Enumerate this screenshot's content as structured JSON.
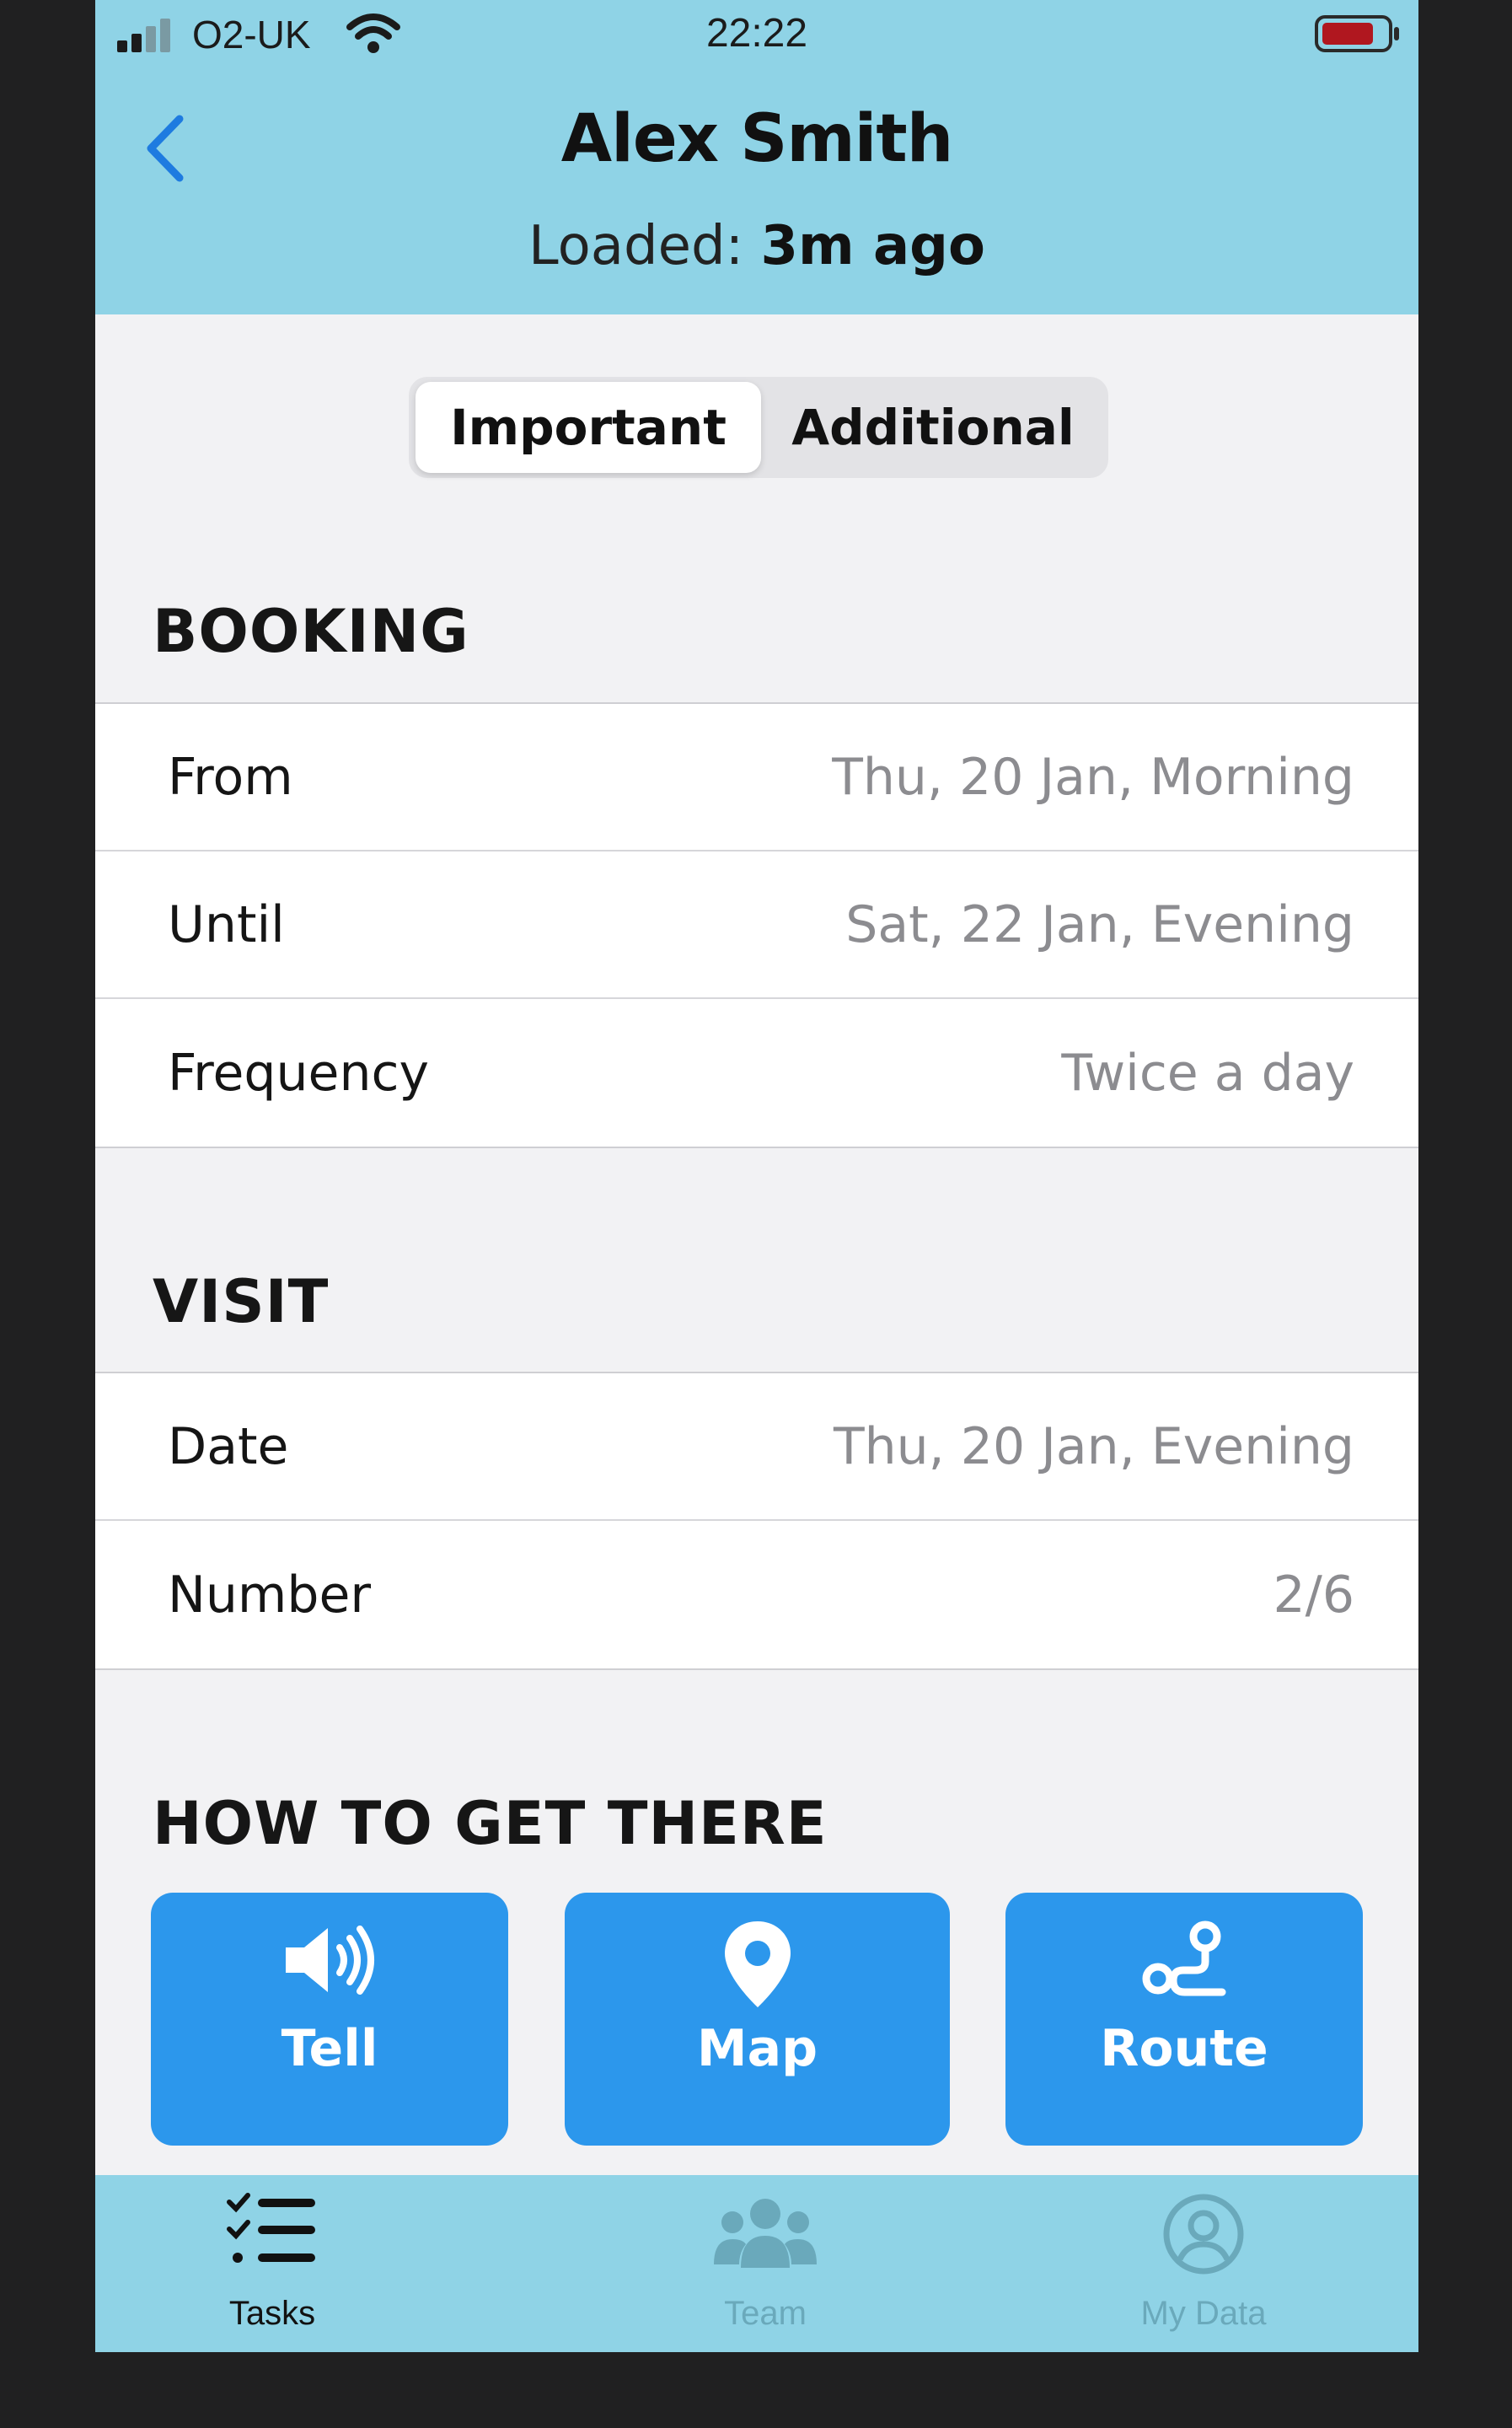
{
  "status_bar": {
    "carrier": "O2-UK",
    "time": "22:22"
  },
  "header": {
    "title": "Alex Smith",
    "loaded_label": "Loaded:",
    "loaded_value": "3m ago",
    "back_icon": "chevron-left-icon"
  },
  "segmented": {
    "options": [
      "Important",
      "Additional"
    ],
    "selected": "Important"
  },
  "booking": {
    "header": "BOOKING",
    "rows": [
      {
        "label": "From",
        "value": "Thu, 20 Jan, Morning"
      },
      {
        "label": "Until",
        "value": "Sat, 22 Jan, Evening"
      },
      {
        "label": "Frequency",
        "value": "Twice a day"
      }
    ]
  },
  "visit": {
    "header": "VISIT",
    "rows": [
      {
        "label": "Date",
        "value": "Thu, 20 Jan, Evening"
      },
      {
        "label": "Number",
        "value": "2/6"
      }
    ]
  },
  "directions": {
    "header": "HOW TO GET THERE",
    "buttons": [
      {
        "label": "Tell",
        "icon": "speaker-icon"
      },
      {
        "label": "Map",
        "icon": "map-pin-icon"
      },
      {
        "label": "Route",
        "icon": "route-icon"
      }
    ]
  },
  "tab_bar": {
    "tabs": [
      {
        "label": "Tasks",
        "icon": "tasks-list-icon"
      },
      {
        "label": "Team",
        "icon": "team-icon"
      },
      {
        "label": "My Data",
        "icon": "user-circle-icon"
      }
    ],
    "active": "Tasks"
  },
  "colors": {
    "header_bg": "#8fd3e6",
    "accent_blue": "#2c97ec",
    "back_chevron": "#1e7be0"
  }
}
